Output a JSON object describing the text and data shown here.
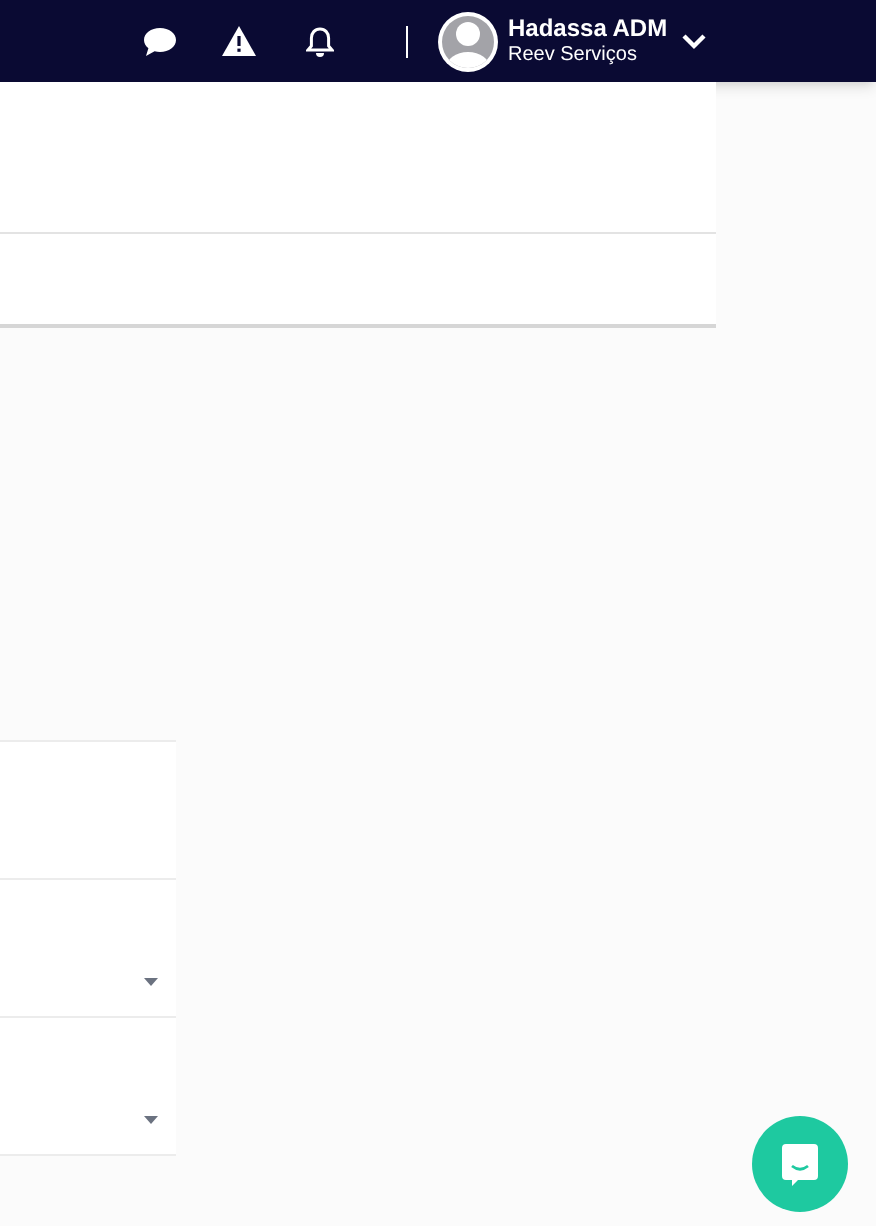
{
  "header": {
    "user": {
      "name": "Hadassa ADM",
      "company": "Reev Serviços"
    }
  },
  "form": {
    "fields": [
      {
        "kind": "text"
      },
      {
        "kind": "select"
      },
      {
        "kind": "select"
      }
    ]
  }
}
